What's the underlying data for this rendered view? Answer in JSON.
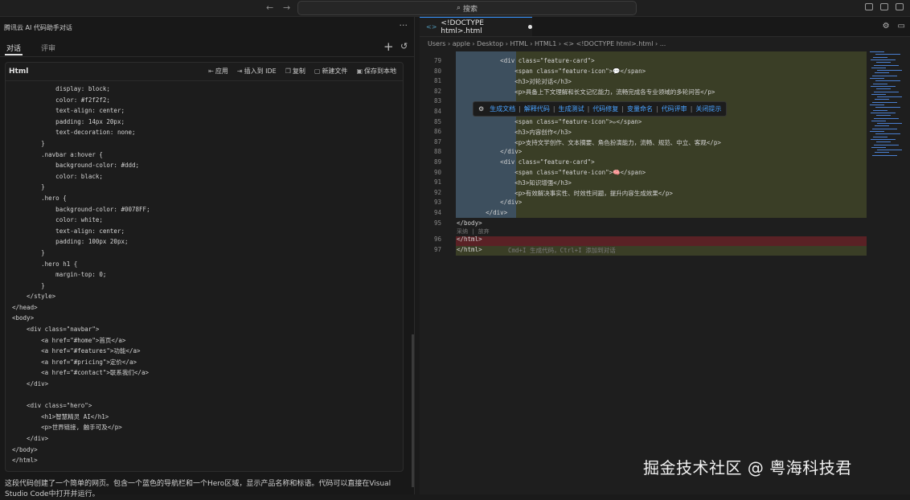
{
  "topbar": {
    "back": "←",
    "forward": "→",
    "search_placeholder": "搜索",
    "search_icon": "search-icon"
  },
  "left_panel": {
    "title": "腾讯云 AI 代码助手对话",
    "more": "···",
    "tabs": [
      {
        "label": "对话",
        "active": true
      },
      {
        "label": "评审",
        "active": false
      }
    ],
    "add": "+",
    "history": "↺",
    "code_card": {
      "language": "Html",
      "actions": [
        {
          "icon": "apply-icon",
          "label": "应用"
        },
        {
          "icon": "insert-icon",
          "label": "插入到 IDE"
        },
        {
          "icon": "copy-icon",
          "label": "复制"
        },
        {
          "icon": "new-file-icon",
          "label": "新建文件"
        },
        {
          "icon": "save-icon",
          "label": "保存到本地"
        }
      ],
      "code_lines": [
        "            display: block;",
        "            color: #f2f2f2;",
        "            text-align: center;",
        "            padding: 14px 20px;",
        "            text-decoration: none;",
        "        }",
        "        .navbar a:hover {",
        "            background-color: #ddd;",
        "            color: black;",
        "        }",
        "        .hero {",
        "            background-color: #0078FF;",
        "            color: white;",
        "            text-align: center;",
        "            padding: 100px 20px;",
        "        }",
        "        .hero h1 {",
        "            margin-top: 0;",
        "        }",
        "    </style>",
        "</head>",
        "<body>",
        "    <div class=\"navbar\">",
        "        <a href=\"#home\">首页</a>",
        "        <a href=\"#features\">功能</a>",
        "        <a href=\"#pricing\">定价</a>",
        "        <a href=\"#contact\">联系我们</a>",
        "    </div>",
        "",
        "    <div class=\"hero\">",
        "        <h1>智慧精灵 AI</h1>",
        "        <p>世界链接, 触手可及</p>",
        "    </div>",
        "</body>",
        "</html>"
      ]
    },
    "explanation": "这段代码创建了一个简单的网页。包含一个蓝色的导航栏和一个Hero区域，显示产品名称和标语。代码可以直接在Visual Studio Code中打开并运行。"
  },
  "editor": {
    "tab": {
      "label": "<!DOCTYPE html>.html",
      "modified": true
    },
    "tools": [
      "gear-icon",
      "layout-icon"
    ],
    "breadcrumb": "Users  ›  apple  ›  Desktop  ›  HTML  ›  HTML1  ›  <> <!DOCTYPE html>.html  ›  ...",
    "lines": [
      {
        "num": "79",
        "text": "            <div class=\"feature-card\">"
      },
      {
        "num": "80",
        "text": "                <span class=\"feature-icon\">💬</span>"
      },
      {
        "num": "81",
        "text": "                <h3>对轮对话</h3>"
      },
      {
        "num": "82",
        "text": "                <p>具备上下文理解和长文记忆能力，流畅完成各专业领域的多轮问答</p>"
      },
      {
        "num": "83",
        "text": ""
      },
      {
        "num": "84",
        "text": ""
      },
      {
        "num": "85",
        "text": "                <span class=\"feature-icon\">✏</span>"
      },
      {
        "num": "86",
        "text": "                <h3>内容创作</h3>"
      },
      {
        "num": "87",
        "text": "                <p>支持文学创作、文本摘要、角色扮演能力，流畅、规范、中立、客观</p>"
      },
      {
        "num": "88",
        "text": "            </div>"
      },
      {
        "num": "89",
        "text": "            <div class=\"feature-card\">"
      },
      {
        "num": "90",
        "text": "                <span class=\"feature-icon\">🧠</span>"
      },
      {
        "num": "91",
        "text": "                <h3>知识增强</h3>"
      },
      {
        "num": "92",
        "text": "                <p>有效解决事实性、时效性问题，提升内容生成效果</p>"
      },
      {
        "num": "93",
        "text": "            </div>"
      },
      {
        "num": "94",
        "text": "        </div>"
      },
      {
        "num": "95",
        "text": "</body>"
      },
      {
        "num": "96",
        "text": "</html>"
      },
      {
        "num": "97",
        "text": "</html>"
      }
    ],
    "accept_reject": "采纳 | 放弃",
    "ai_actions": [
      "生成文档",
      "解释代码",
      "生成测试",
      "代码修复",
      "变量命名",
      "代码评审",
      "关闭提示"
    ],
    "inline_hint": "Cmd+I 生成代码，Ctrl+I 添加到对话"
  },
  "watermark": "掘金技术社区 @ 粤海科技君"
}
